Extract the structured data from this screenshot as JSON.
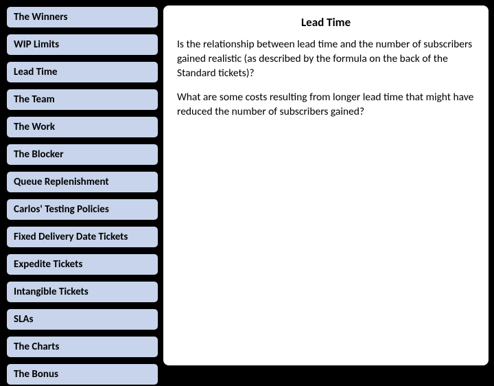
{
  "sidebar": {
    "items": [
      {
        "label": "The Winners"
      },
      {
        "label": "WIP Limits"
      },
      {
        "label": "Lead Time"
      },
      {
        "label": "The Team"
      },
      {
        "label": "The Work"
      },
      {
        "label": "The Blocker"
      },
      {
        "label": "Queue Replenishment"
      },
      {
        "label": "Carlos' Testing Policies"
      },
      {
        "label": "Fixed Delivery Date Tickets"
      },
      {
        "label": "Expedite Tickets"
      },
      {
        "label": "Intangible Tickets"
      },
      {
        "label": "SLAs"
      },
      {
        "label": "The Charts"
      },
      {
        "label": "The Bonus"
      }
    ]
  },
  "content": {
    "title": "Lead Time",
    "paragraphs": [
      "Is the relationship between lead time and the number of subscribers gained realistic (as described by the formula on the back of the Standard tickets)?",
      "What are some costs resulting from longer lead time that might have reduced the number of subscribers gained?"
    ]
  }
}
